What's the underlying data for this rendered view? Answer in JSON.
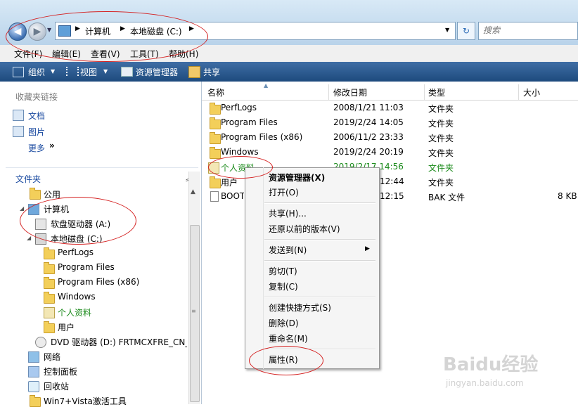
{
  "address": {
    "segments": [
      "计算机",
      "本地磁盘 (C:)"
    ],
    "search_placeholder": "搜索"
  },
  "menubar": [
    "文件(F)",
    "编辑(E)",
    "查看(V)",
    "工具(T)",
    "帮助(H)"
  ],
  "commandbar": [
    "组织",
    "视图",
    "资源管理器",
    "共享"
  ],
  "nav": {
    "favorites_header": "收藏夹链接",
    "favorites": [
      "文档",
      "图片",
      "更多"
    ],
    "folders_header": "文件夹",
    "tree": [
      "公用",
      "计算机",
      "软盘驱动器 (A:)",
      "本地磁盘 (C:)",
      "PerfLogs",
      "Program Files",
      "Program Files (x86)",
      "Windows",
      "个人资料",
      "用户",
      "DVD 驱动器 (D:) FRTMCXFRE_CN_I",
      "网络",
      "控制面板",
      "回收站",
      "Win7+Vista激活工具"
    ]
  },
  "columns": [
    "名称",
    "修改日期",
    "类型",
    "大小"
  ],
  "files": [
    {
      "name": "PerfLogs",
      "date": "2008/1/21 11:03",
      "type": "文件夹",
      "size": ""
    },
    {
      "name": "Program Files",
      "date": "2019/2/24 14:05",
      "type": "文件夹",
      "size": ""
    },
    {
      "name": "Program Files (x86)",
      "date": "2006/11/2 23:33",
      "type": "文件夹",
      "size": ""
    },
    {
      "name": "Windows",
      "date": "2019/2/24 20:19",
      "type": "文件夹",
      "size": ""
    },
    {
      "name": "个人资料",
      "date": "2019/2/17 14:56",
      "type": "文件夹",
      "size": ""
    },
    {
      "name": "用户",
      "date": "12:44",
      "type": "文件夹",
      "size": ""
    },
    {
      "name": "BOOT",
      "date": "12:15",
      "type": "BAK 文件",
      "size": "8 KB"
    }
  ],
  "context_menu": [
    "资源管理器(X)",
    "打开(O)",
    "共享(H)...",
    "还原以前的版本(V)",
    "发送到(N)",
    "剪切(T)",
    "复制(C)",
    "创建快捷方式(S)",
    "删除(D)",
    "重命名(M)",
    "属性(R)"
  ],
  "watermark": {
    "brand": "Baidu经验",
    "url": "jingyan.baidu.com"
  },
  "colors": {
    "highlight_green": "#1a8a1a",
    "accent_blue": "#1d4a7d",
    "annotation_red": "#d42020"
  }
}
